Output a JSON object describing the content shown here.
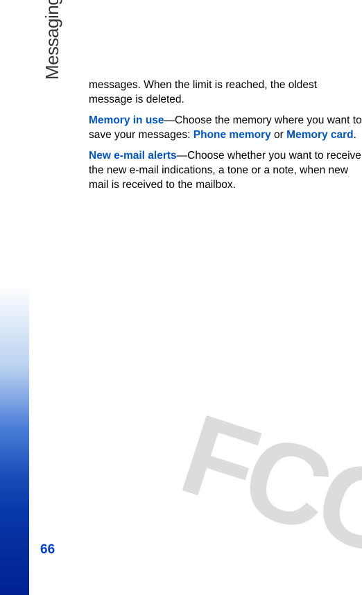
{
  "sidebar": {
    "section_title": "Messaging"
  },
  "page": {
    "number": "66"
  },
  "content": {
    "para1_part1": "messages. When the limit is reached, the oldest message is deleted.",
    "para2_label": "Memory in use",
    "para2_dash": "—Choose the memory where you want to save your messages: ",
    "para2_option1": "Phone memory",
    "para2_or": " or ",
    "para2_option2": "Memory card",
    "para2_end": ".",
    "para3_label": "New e-mail alerts",
    "para3_text": "—Choose whether you want to receive the new e-mail indications, a tone or a note, when new mail is received to the mailbox."
  },
  "watermark": {
    "text": "FCC"
  }
}
